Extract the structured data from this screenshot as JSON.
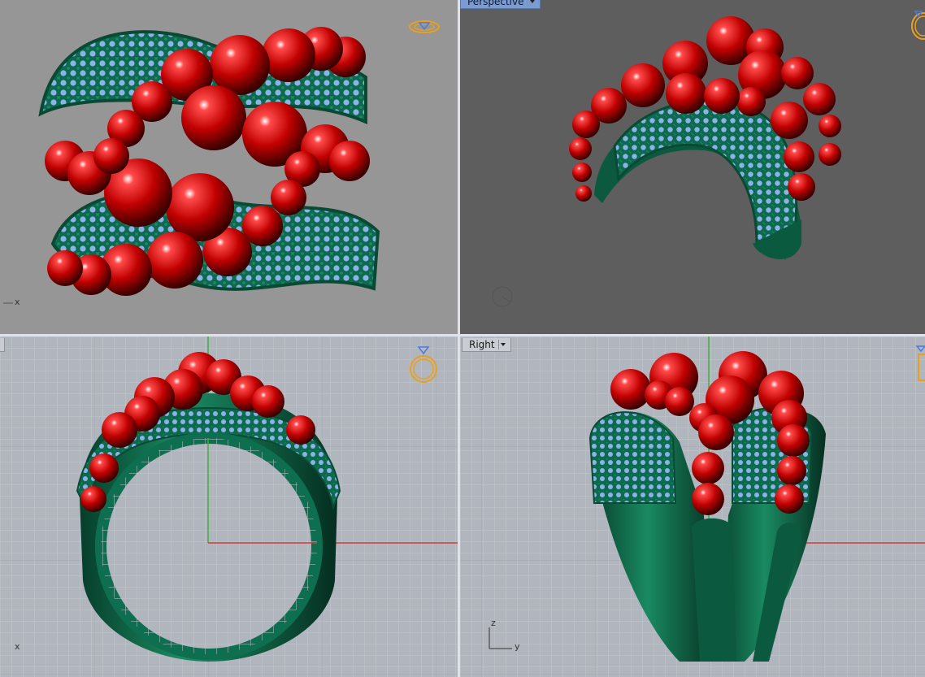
{
  "viewports": {
    "top": {
      "name": "",
      "axis_labels": [
        "x"
      ]
    },
    "perspective": {
      "name": "Perspective"
    },
    "front": {
      "name": "",
      "axis_labels": [
        "x"
      ]
    },
    "right": {
      "name": "Right",
      "axis_labels": [
        "z",
        "y"
      ]
    }
  },
  "colors": {
    "viewport_bg_shaded": "#969696",
    "viewport_bg_perspective": "#5e5e5e",
    "viewport_bg_grid": "#b1b5bd",
    "grid_line": "#c2c6cd",
    "grid_major": "#a6aab2",
    "axis_x": "#c84040",
    "axis_y": "#3fb040",
    "band_green": "#0d6f50",
    "gem_blue": "#8ab4e8",
    "pearl_red": "#c00000",
    "widget_gold": "#e8a020",
    "widget_blue": "#4a7ae0",
    "active_tab": "#7c9bd0"
  },
  "icons": [
    "ring-view-icon",
    "dropdown-arrow-icon",
    "axis-triad-icon"
  ]
}
